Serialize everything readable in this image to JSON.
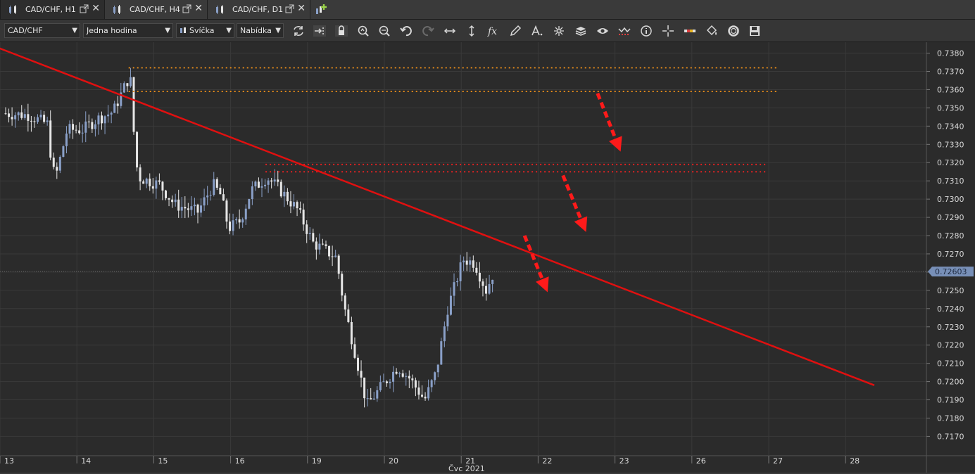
{
  "tabs": [
    {
      "label": "CAD/CHF, H1",
      "active": true
    },
    {
      "label": "CAD/CHF, H4",
      "active": false
    },
    {
      "label": "CAD/CHF, D1",
      "active": false
    }
  ],
  "toolbar": {
    "symbol": "CAD/CHF",
    "timeframe": "Jedna hodina",
    "chart_type": "Svíčka",
    "price_type": "Nabídka",
    "tools": [
      "refresh-icon",
      "auto-scroll-icon",
      "lock-icon",
      "zoom-in-icon",
      "zoom-out-icon",
      "undo-icon",
      "redo-icon",
      "horizontal-line-icon",
      "vertical-line-icon",
      "formula-fx-icon",
      "pencil-icon",
      "text-tool-icon",
      "crosshair-icon",
      "layers-icon",
      "eye-icon",
      "indicator-wave-icon",
      "info-icon",
      "cursor-cross-icon",
      "color-palette-icon",
      "paint-bucket-icon",
      "settings-ring-icon",
      "save-icon"
    ]
  },
  "colors": {
    "background": "#2b2b2b",
    "grid": "#3a3a3a",
    "candle_up": "#8aa0c8",
    "candle_down": "#e6e6e6",
    "trendline": "#e01010",
    "resistance_orange": "#e48a1a",
    "resistance_red": "#e02222",
    "arrow": "#ff1a1a",
    "price_tag_bg": "#7890b8"
  },
  "chart_data": {
    "type": "candlestick",
    "symbol": "CAD/CHF",
    "ylim": [
      0.7164,
      0.7386
    ],
    "y_ticks": [
      "0.7380",
      "0.7370",
      "0.7360",
      "0.7350",
      "0.7340",
      "0.7330",
      "0.7320",
      "0.7310",
      "0.7300",
      "0.7290",
      "0.7280",
      "0.7270",
      "0.7260",
      "0.7250",
      "0.7240",
      "0.7230",
      "0.7220",
      "0.7210",
      "0.7200",
      "0.7190",
      "0.7180",
      "0.7170"
    ],
    "current_price": "0.72603",
    "x_ticks": [
      "13",
      "14",
      "15",
      "16",
      "19",
      "20",
      "21",
      "22",
      "23",
      "26",
      "27",
      "28"
    ],
    "x_month_label": "Čvc 2021",
    "close_path": [
      [
        0.0,
        0.7347
      ],
      [
        0.3,
        0.7346
      ],
      [
        0.55,
        0.7341
      ],
      [
        0.6,
        0.7318
      ],
      [
        0.65,
        0.7312
      ],
      [
        0.8,
        0.7338
      ],
      [
        1.0,
        0.7338
      ],
      [
        1.2,
        0.7344
      ],
      [
        1.4,
        0.7348
      ],
      [
        1.55,
        0.7362
      ],
      [
        1.62,
        0.7368
      ],
      [
        1.66,
        0.734
      ],
      [
        1.72,
        0.7312
      ],
      [
        2.0,
        0.7308
      ],
      [
        2.2,
        0.7297
      ],
      [
        2.5,
        0.7293
      ],
      [
        2.7,
        0.7308
      ],
      [
        2.8,
        0.7302
      ],
      [
        2.9,
        0.7284
      ],
      [
        3.05,
        0.7288
      ],
      [
        3.2,
        0.7305
      ],
      [
        3.4,
        0.7312
      ],
      [
        3.55,
        0.7306
      ],
      [
        3.8,
        0.7294
      ],
      [
        4.0,
        0.7276
      ],
      [
        4.3,
        0.7268
      ],
      [
        4.4,
        0.7242
      ],
      [
        4.55,
        0.7215
      ],
      [
        4.7,
        0.7187
      ],
      [
        4.9,
        0.7198
      ],
      [
        5.1,
        0.7208
      ],
      [
        5.25,
        0.7202
      ],
      [
        5.45,
        0.719
      ],
      [
        5.6,
        0.7205
      ],
      [
        5.75,
        0.724
      ],
      [
        5.95,
        0.7267
      ],
      [
        6.1,
        0.7265
      ],
      [
        6.25,
        0.725
      ],
      [
        6.35,
        0.726
      ]
    ],
    "trendline": {
      "start": [
        -0.1,
        0.7383
      ],
      "end": [
        11.3,
        0.7198
      ]
    },
    "resistance_levels": [
      {
        "price": 0.7372,
        "x_from": 1.6,
        "x_to": 10.05,
        "color": "orange"
      },
      {
        "price": 0.7359,
        "x_from": 1.6,
        "x_to": 10.05,
        "color": "orange"
      },
      {
        "price": 0.7319,
        "x_from": 3.38,
        "x_to": 9.9,
        "color": "red"
      },
      {
        "price": 0.7315,
        "x_from": 3.38,
        "x_to": 9.9,
        "color": "red"
      }
    ],
    "arrows": [
      {
        "from": [
          7.7,
          0.7358
        ],
        "to": [
          8.0,
          0.7326
        ]
      },
      {
        "from": [
          7.25,
          0.7313
        ],
        "to": [
          7.55,
          0.7282
        ]
      },
      {
        "from": [
          6.75,
          0.728
        ],
        "to": [
          7.05,
          0.7249
        ]
      }
    ]
  }
}
